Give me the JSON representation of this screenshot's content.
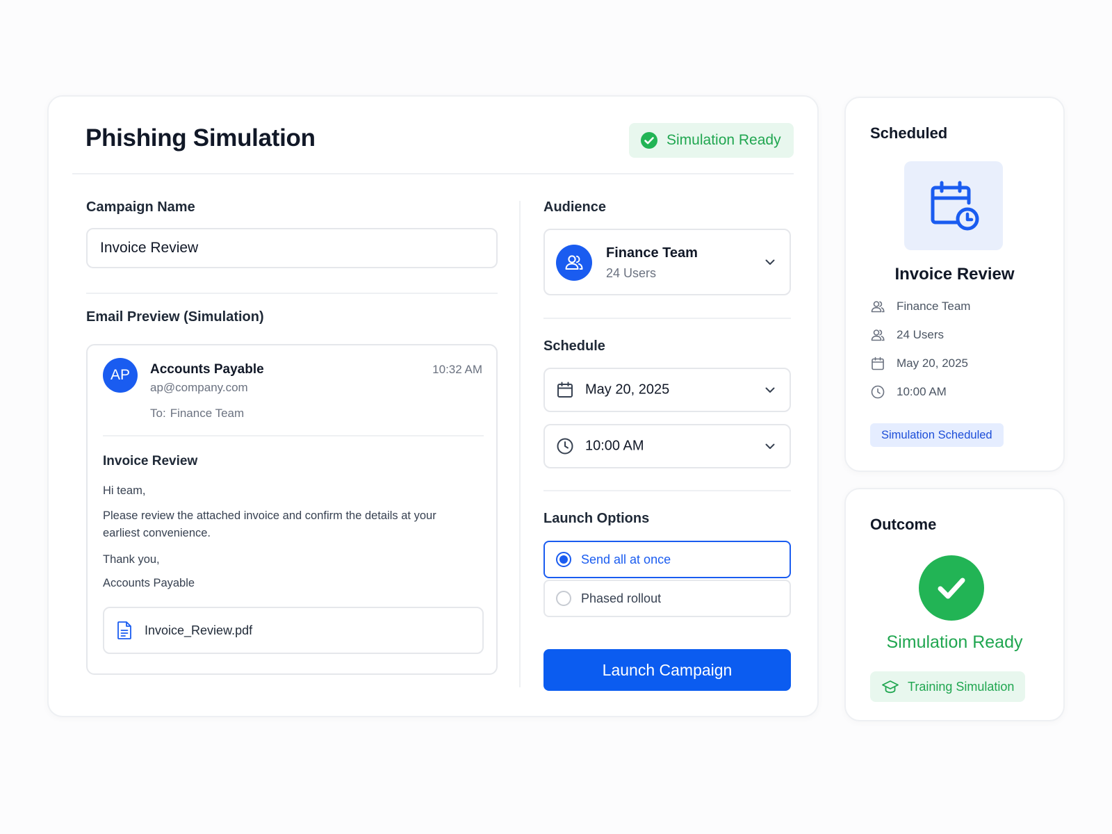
{
  "header": {
    "title": "Phishing Simulation",
    "status_label": "Simulation Ready"
  },
  "form": {
    "campaign_name_label": "Campaign Name",
    "campaign_name_value": "Invoice Review",
    "email_preview_label": "Email Preview (Simulation)",
    "audience_label": "Audience",
    "schedule_label": "Schedule",
    "launch_options_label": "Launch Options"
  },
  "email": {
    "avatar_initials": "AP",
    "sender_name": "Accounts Payable",
    "sender_email": "ap@company.com",
    "time": "10:32 AM",
    "to_label": "To:",
    "to_value": "Finance Team",
    "subject": "Invoice Review",
    "greeting": "Hi team,",
    "body": "Please review the attached invoice and confirm the details at your earliest convenience.",
    "signoff": "Thank you,",
    "signature": "Accounts Payable",
    "attachment": "Invoice_Review.pdf"
  },
  "audience": {
    "name": "Finance Team",
    "count": "24 Users"
  },
  "schedule": {
    "date": "May 20, 2025",
    "time": "10:00 AM"
  },
  "launch_options": [
    {
      "label": "Send all at once",
      "selected": true
    },
    {
      "label": "Phased rollout",
      "selected": false
    }
  ],
  "launch_button": "Launch Campaign",
  "scheduled_card": {
    "title": "Scheduled",
    "name": "Invoice Review",
    "audience": "Finance Team",
    "users": "24 Users",
    "date": "May 20, 2025",
    "time": "10:00 AM",
    "badge": "Simulation Scheduled"
  },
  "outcome_card": {
    "title": "Outcome",
    "status": "Simulation Ready",
    "badge": "Training Simulation"
  },
  "colors": {
    "primary": "#0b5cf0",
    "success": "#22b455",
    "success_bg": "#e8f7ee",
    "info_bg": "#e5edff"
  }
}
